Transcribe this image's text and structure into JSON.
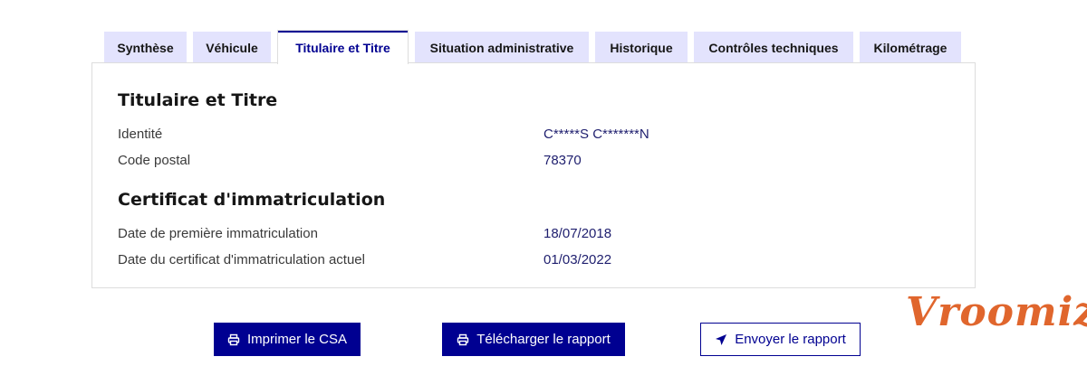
{
  "tabs": [
    {
      "label": "Synthèse",
      "active": false
    },
    {
      "label": "Véhicule",
      "active": false
    },
    {
      "label": "Titulaire et Titre",
      "active": true
    },
    {
      "label": "Situation administrative",
      "active": false
    },
    {
      "label": "Historique",
      "active": false
    },
    {
      "label": "Contrôles techniques",
      "active": false
    },
    {
      "label": "Kilométrage",
      "active": false
    }
  ],
  "titulaire": {
    "heading": "Titulaire et Titre",
    "rows": [
      {
        "label": "Identité",
        "value": "C*****S C*******N"
      },
      {
        "label": "Code postal",
        "value": "78370"
      }
    ]
  },
  "certificat": {
    "heading": "Certificat d'immatriculation",
    "rows": [
      {
        "label": "Date de première immatriculation",
        "value": "18/07/2018"
      },
      {
        "label": "Date du certificat d'immatriculation actuel",
        "value": "01/03/2022"
      }
    ]
  },
  "actions": {
    "print_label": "Imprimer le CSA",
    "download_label": "Télécharger le rapport",
    "send_label": "Envoyer le rapport"
  },
  "brand": {
    "logo_text": "Vroomiz",
    "primary_color": "#000091",
    "logo_color": "#e0662d"
  }
}
